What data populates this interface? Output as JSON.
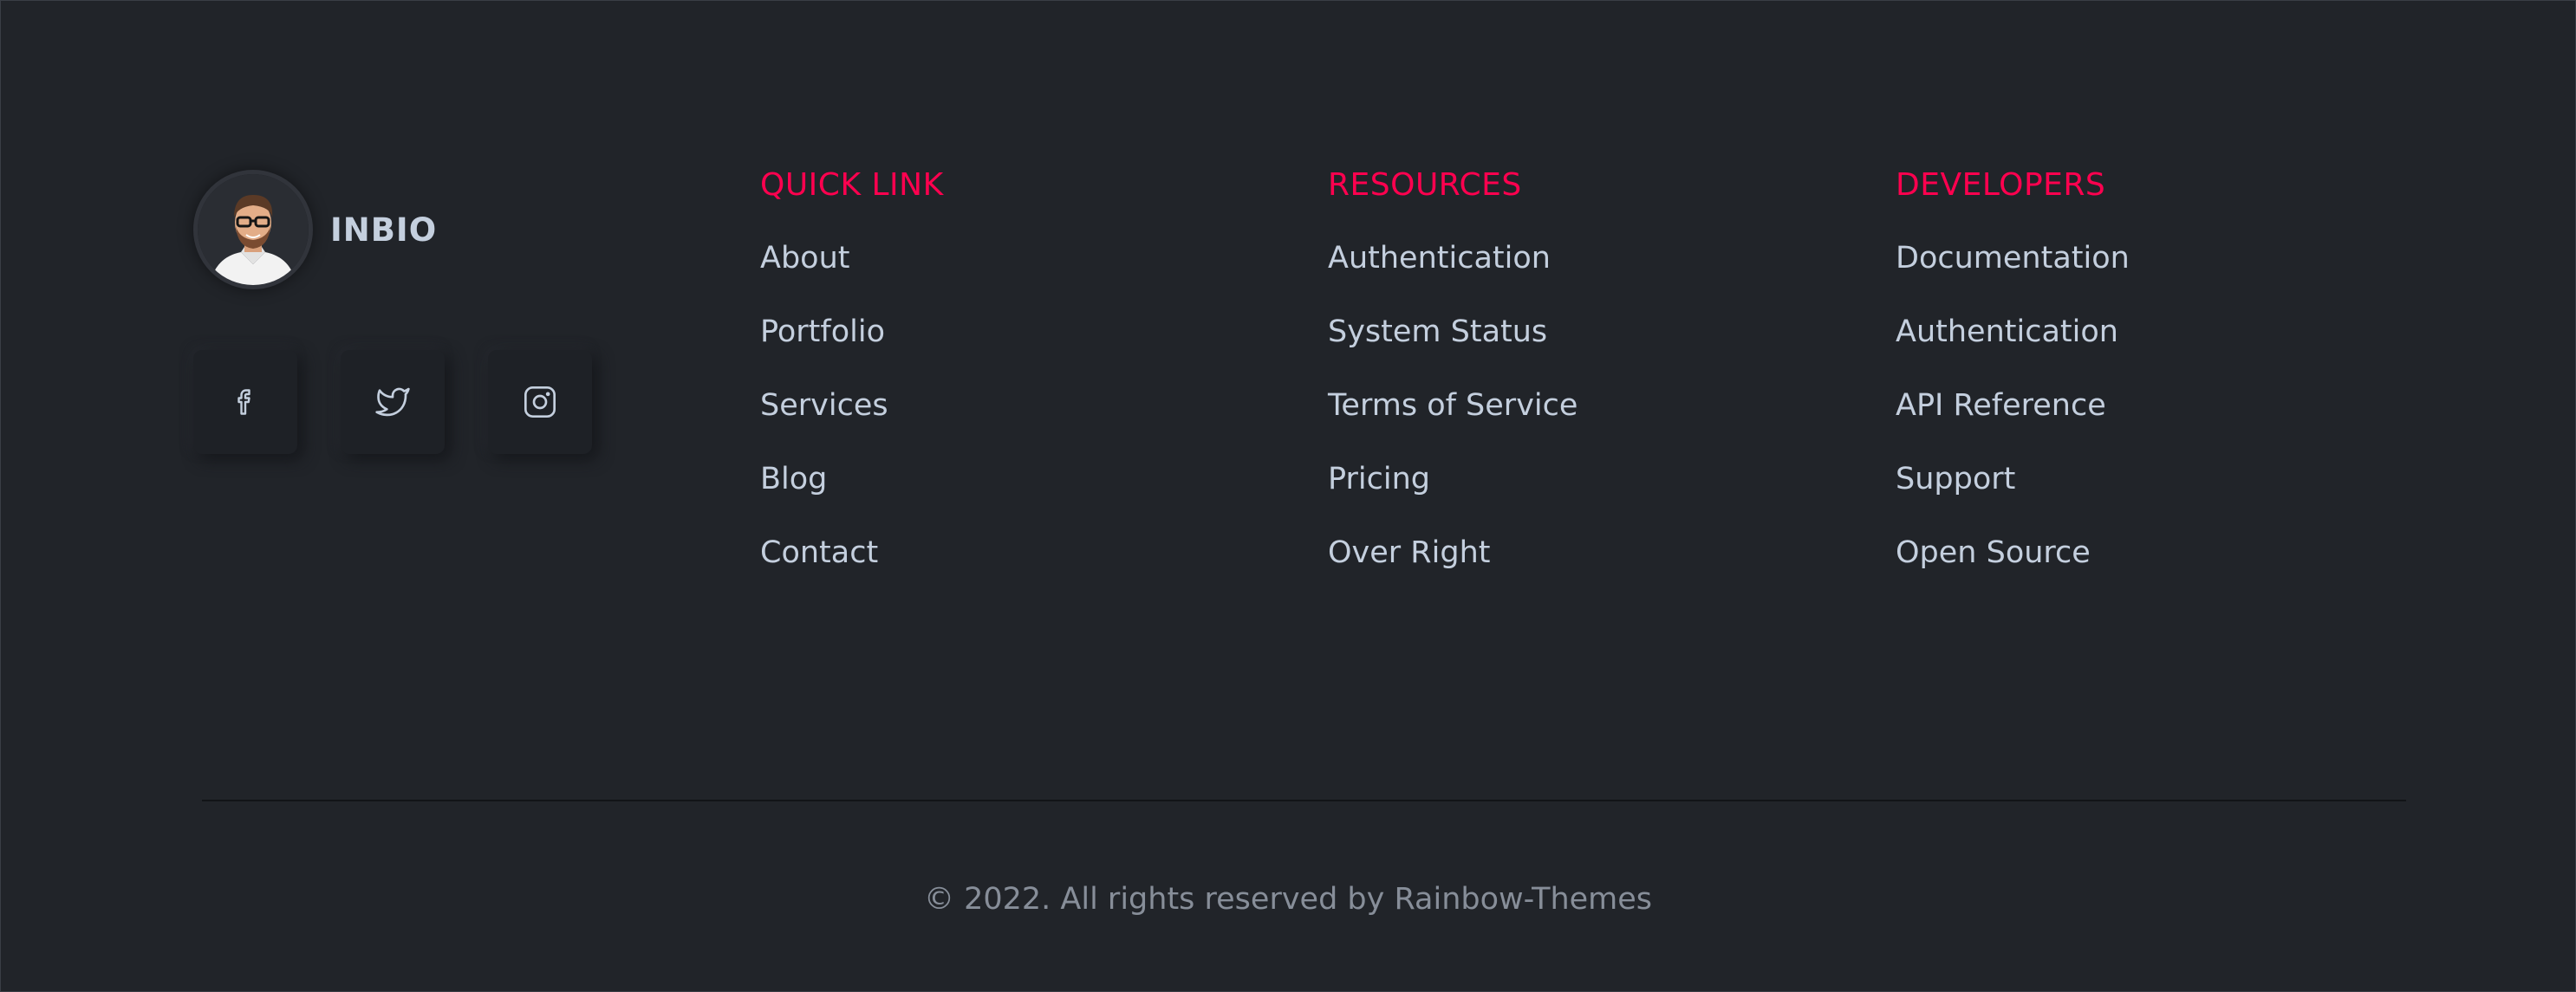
{
  "brand": {
    "name": "INBIO",
    "avatar_alt": "avatar"
  },
  "socials": [
    {
      "icon": "facebook-icon"
    },
    {
      "icon": "twitter-icon"
    },
    {
      "icon": "instagram-icon"
    }
  ],
  "columns": [
    {
      "title": "QUICK LINK",
      "items": [
        "About",
        "Portfolio",
        "Services",
        "Blog",
        "Contact"
      ]
    },
    {
      "title": "RESOURCES",
      "items": [
        "Authentication",
        "System Status",
        "Terms of Service",
        "Pricing",
        "Over Right"
      ]
    },
    {
      "title": "DEVELOPERS",
      "items": [
        "Documentation",
        "Authentication",
        "API Reference",
        "Support",
        "Open Source"
      ]
    }
  ],
  "copyright": "© 2022. All rights reserved by Rainbow-Themes",
  "colors": {
    "background": "#212429",
    "accent": "#ff014f",
    "text": "#c4cfde",
    "muted": "#878e99"
  }
}
